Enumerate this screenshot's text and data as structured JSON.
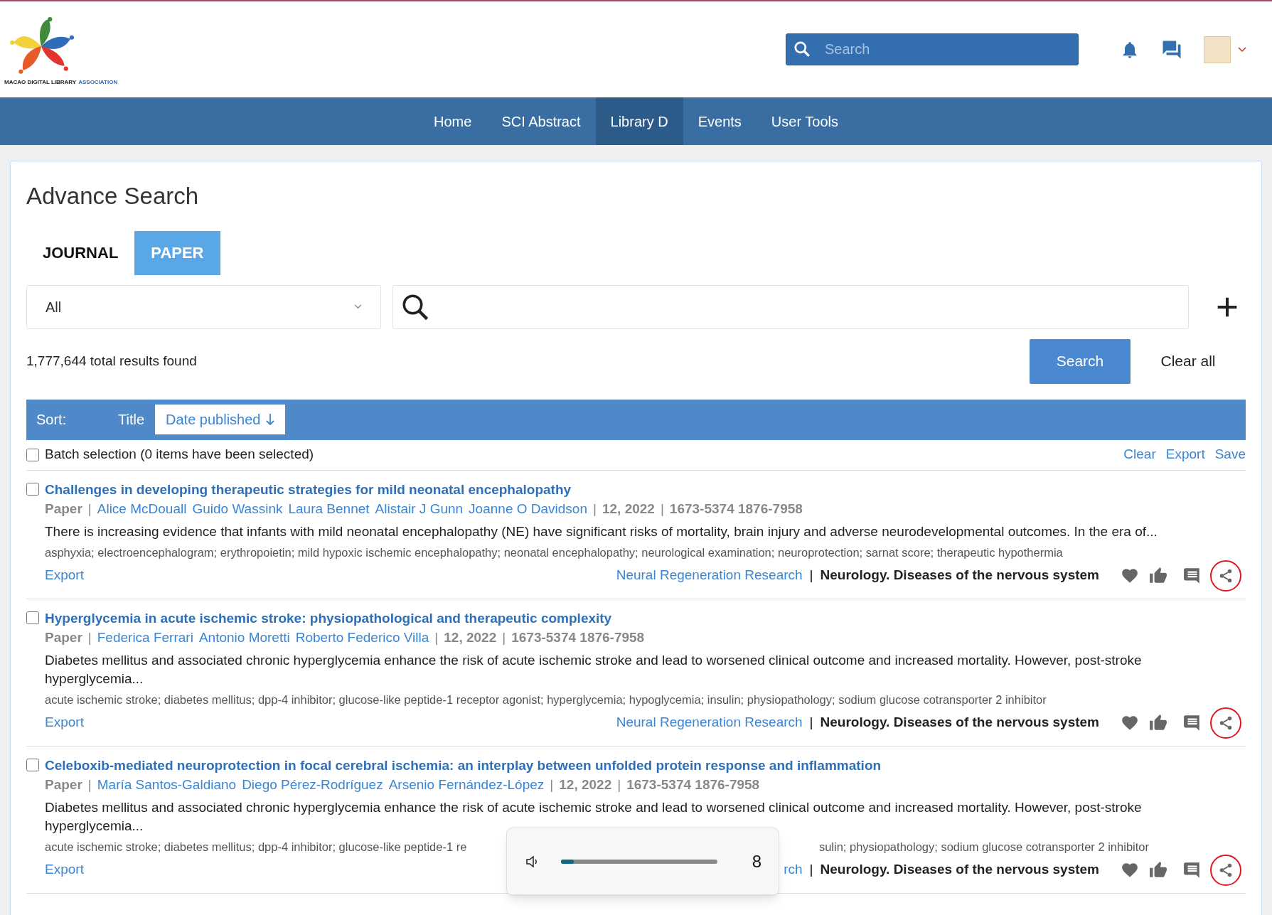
{
  "logo": {
    "text": "MACAO DIGITAL LIBRARY",
    "text_accent": "ASSOCIATION"
  },
  "header_search": {
    "placeholder": "Search"
  },
  "nav": [
    {
      "label": "Home",
      "selected": false
    },
    {
      "label": "SCI Abstract",
      "selected": false
    },
    {
      "label": "Library D",
      "selected": true
    },
    {
      "label": "Events",
      "selected": false
    },
    {
      "label": "User Tools",
      "selected": false
    }
  ],
  "page_title": "Advance Search",
  "tabs": [
    {
      "label": "JOURNAL",
      "selected": false
    },
    {
      "label": "PAPER",
      "selected": true
    }
  ],
  "field_select": {
    "value": "All"
  },
  "results_count": "1,777,644 total results found",
  "search_button": "Search",
  "clear_all": "Clear all",
  "sort": {
    "label": "Sort:",
    "options": [
      {
        "label": "Title",
        "selected": false
      },
      {
        "label": "Date published",
        "selected": true
      }
    ]
  },
  "batch": {
    "label": "Batch selection (0 items have been selected)",
    "checked": false,
    "actions": [
      "Clear",
      "Export",
      "Save"
    ]
  },
  "results": [
    {
      "checked": false,
      "title": "Challenges in developing therapeutic strategies for mild neonatal encephalopathy",
      "type": "Paper",
      "authors": [
        "Alice McDouall",
        "Guido Wassink",
        "Laura Bennet",
        "Alistair J Gunn",
        "Joanne O Davidson"
      ],
      "date": "12, 2022",
      "issn": "1673-5374 1876-7958",
      "abstract": "There is increasing evidence that infants with mild neonatal encephalopathy (NE) have significant risks of mortality, brain injury and adverse neurodevelopmental outcomes. In the era of...",
      "keywords": [
        "asphyxia; electroencephalogram; erythropoietin; mild hypoxic ischemic encephalopathy; neonatal encephalopathy; neurological examination; neuroprotection; sarnat score; therapeutic hypothermia"
      ],
      "export": "Export",
      "journal": "Neural Regeneration Research",
      "separator": "|",
      "category": "Neurology. Diseases of the nervous system"
    },
    {
      "checked": false,
      "title": "Hyperglycemia in acute ischemic stroke: physiopathological and therapeutic complexity",
      "type": "Paper",
      "authors": [
        "Federica Ferrari",
        "Antonio Moretti",
        "Roberto Federico Villa"
      ],
      "date": "12, 2022",
      "issn": "1673-5374 1876-7958",
      "abstract": "Diabetes mellitus and associated chronic hyperglycemia enhance the risk of acute ischemic stroke and lead to worsened clinical outcome and increased mortality. However, post-stroke hyperglycemia...",
      "keywords": [
        "acute ischemic stroke; diabetes mellitus; dpp-4 inhibitor; glucose-like peptide-1 receptor agonist; hyperglycemia; hypoglycemia; insulin; physiopathology; sodium glucose cotransporter 2 inhibitor"
      ],
      "export": "Export",
      "journal": "Neural Regeneration Research",
      "separator": "|",
      "category": "Neurology. Diseases of the nervous system"
    },
    {
      "checked": false,
      "title": "Celeboxib-mediated neuroprotection in focal cerebral ischemia: an interplay between unfolded protein response and inflammation",
      "type": "Paper",
      "authors": [
        "María Santos-Galdiano",
        "Diego Pérez-Rodríguez",
        "Arsenio Fernández-López"
      ],
      "date": "12, 2022",
      "issn": "1673-5374 1876-7958",
      "abstract": "Diabetes mellitus and associated chronic hyperglycemia enhance the risk of acute ischemic stroke and lead to worsened clinical outcome and increased mortality. However, post-stroke hyperglycemia...",
      "keywords": [
        "acute ischemic stroke; diabetes mellitus; dpp-4 inhibitor; glucose-like peptide-1 re",
        "sulin; physiopathology; sodium glucose cotransporter 2 inhibitor"
      ],
      "export": "Export",
      "journal": "rch",
      "separator": "|",
      "category": "Neurology. Diseases of the nervous system"
    }
  ],
  "volume_flyout": {
    "level": 0.08,
    "reading": "8"
  }
}
